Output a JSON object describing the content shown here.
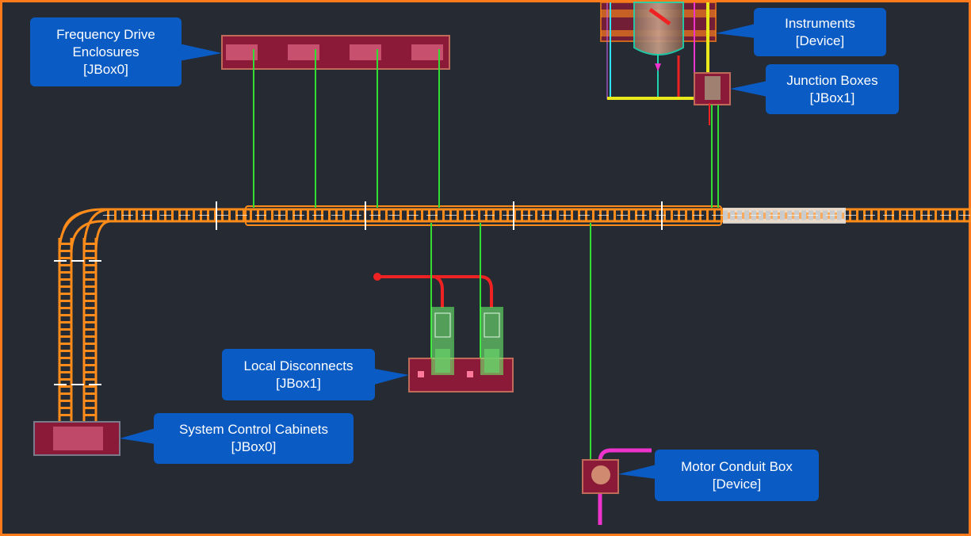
{
  "callouts": {
    "frequency_drive": {
      "line1": "Frequency Drive",
      "line2": "Enclosures",
      "line3": "[JBox0]"
    },
    "instruments": {
      "line1": "Instruments",
      "line2": "[Device]"
    },
    "junction_boxes": {
      "line1": "Junction Boxes",
      "line2": "[JBox1]"
    },
    "local_disconnects": {
      "line1": "Local Disconnects",
      "line2": "[JBox1]"
    },
    "system_control": {
      "line1": "System Control Cabinets",
      "line2": "[JBox0]"
    },
    "motor_conduit": {
      "line1": "Motor Conduit Box",
      "line2": "[Device]"
    }
  },
  "colors": {
    "background": "#252a33",
    "frame": "#ff7a1a",
    "tray": "#ff8c1a",
    "enclosure": "#8b1a38",
    "callout": "#0a5bc4",
    "wire": "#33dd33",
    "pipe_red": "#ee2222",
    "pipe_magenta": "#ee33cc",
    "yellow_frame": "#e8e81a",
    "tank": "#1fd6b0"
  }
}
